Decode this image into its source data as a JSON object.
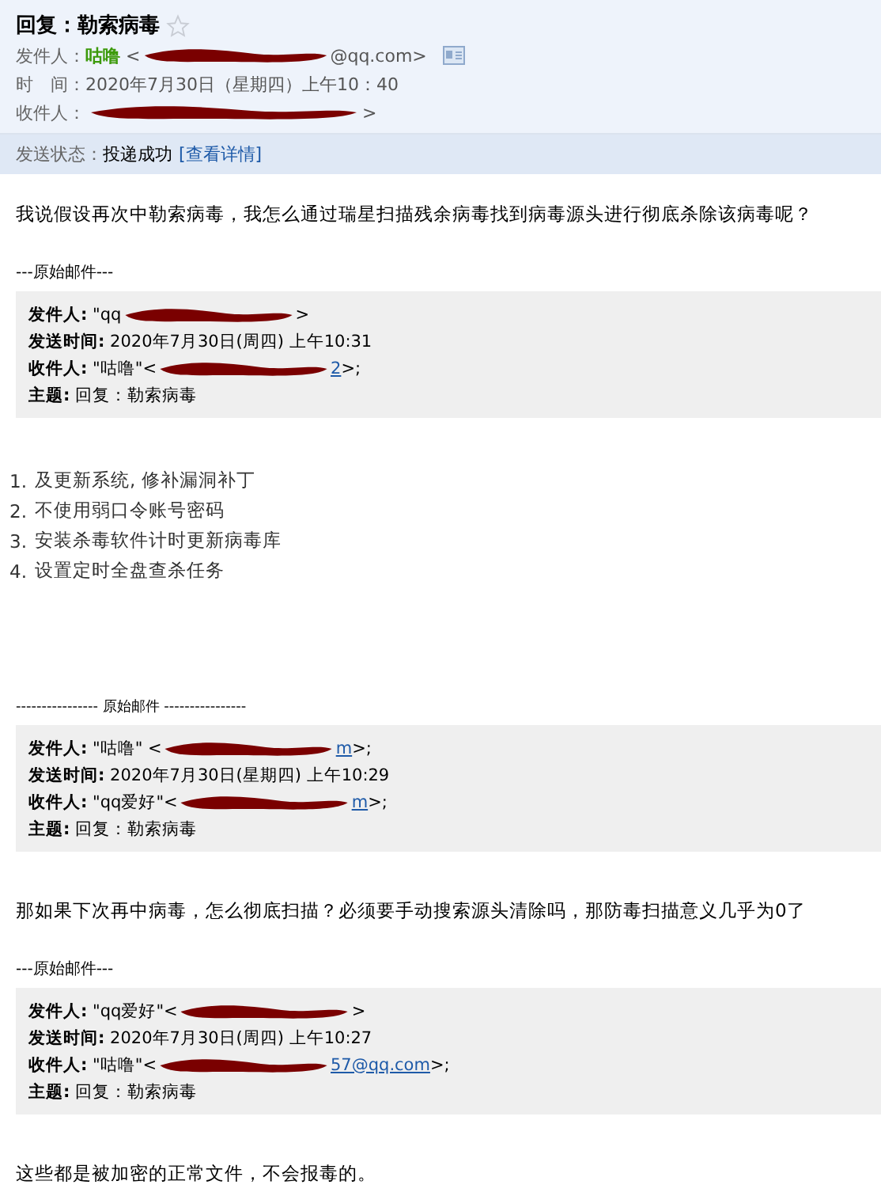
{
  "header": {
    "subject": "回复：勒索病毒",
    "starred": false,
    "fields": [
      {
        "kind": "sender",
        "label": "发件人：",
        "name": "咕噜",
        "prefix": "<",
        "redacted": true,
        "suffix": "@qq.com>"
      },
      {
        "kind": "plain",
        "label": "时　间：",
        "text": "2020年7月30日（星期四）上午10：40"
      },
      {
        "kind": "recipient",
        "label": "收件人：",
        "redacted": true,
        "suffix": ">"
      }
    ],
    "status": {
      "label": "发送状态：",
      "value": "投递成功",
      "link": "[查看详情]"
    }
  },
  "body": [
    {
      "kind": "para",
      "text": "我说假设再次中勒索病毒，我怎么通过瑞星扫描残余病毒找到病毒源头进行彻底杀除该病毒呢？"
    },
    {
      "kind": "sep",
      "text": "---原始邮件---"
    },
    {
      "kind": "quote",
      "lines": [
        {
          "label": "发件人:",
          "prefix": "\"qq",
          "redacted": true,
          "suffix": ">"
        },
        {
          "label": "发送时间:",
          "text": "2020年7月30日(周四) 上午10:31"
        },
        {
          "label": "收件人:",
          "prefix": "\"咕噜\"<",
          "redacted": true,
          "link": "2",
          "suffix": ">;"
        },
        {
          "label": "主题:",
          "text": "回复：勒索病毒"
        }
      ]
    },
    {
      "kind": "list",
      "items": [
        {
          "number": "1.",
          "text": "及更新系统, 修补漏洞补丁"
        },
        {
          "number": "2.",
          "text": "不使用弱口令账号密码"
        },
        {
          "number": "3.",
          "text": "安装杀毒软件计时更新病毒库"
        },
        {
          "number": "4.",
          "text": "设置定时全盘查杀任务"
        }
      ]
    },
    {
      "kind": "sep2",
      "text": "---------------- 原始邮件 ----------------"
    },
    {
      "kind": "quote",
      "lines": [
        {
          "label": "发件人:",
          "prefix": "\"咕噜\" <",
          "redacted": true,
          "link": "m",
          "suffix": ">;"
        },
        {
          "label": "发送时间:",
          "text": "2020年7月30日(星期四) 上午10:29"
        },
        {
          "label": "收件人:",
          "prefix": "\"qq爱好\"<",
          "redacted": true,
          "link": "m",
          "suffix": ">;"
        },
        {
          "label": "主题:",
          "text": "回复：勒索病毒"
        }
      ]
    },
    {
      "kind": "para",
      "text": "那如果下次再中病毒，怎么彻底扫描？必须要手动搜索源头清除吗，那防毒扫描意义几乎为0了"
    },
    {
      "kind": "sep",
      "text": "---原始邮件---"
    },
    {
      "kind": "quote",
      "lines": [
        {
          "label": "发件人:",
          "prefix": "\"qq爱好\"<",
          "redacted": true,
          "suffix": ">"
        },
        {
          "label": "发送时间:",
          "text": "2020年7月30日(周四) 上午10:27"
        },
        {
          "label": "收件人:",
          "prefix": "\"咕噜\"<",
          "redacted": true,
          "link": "57@qq.com",
          "suffix": ">;"
        },
        {
          "label": "主题:",
          "text": "回复：勒索病毒"
        }
      ]
    },
    {
      "kind": "para",
      "text": "这些都是被加密的正常文件，不会报毒的。"
    }
  ]
}
